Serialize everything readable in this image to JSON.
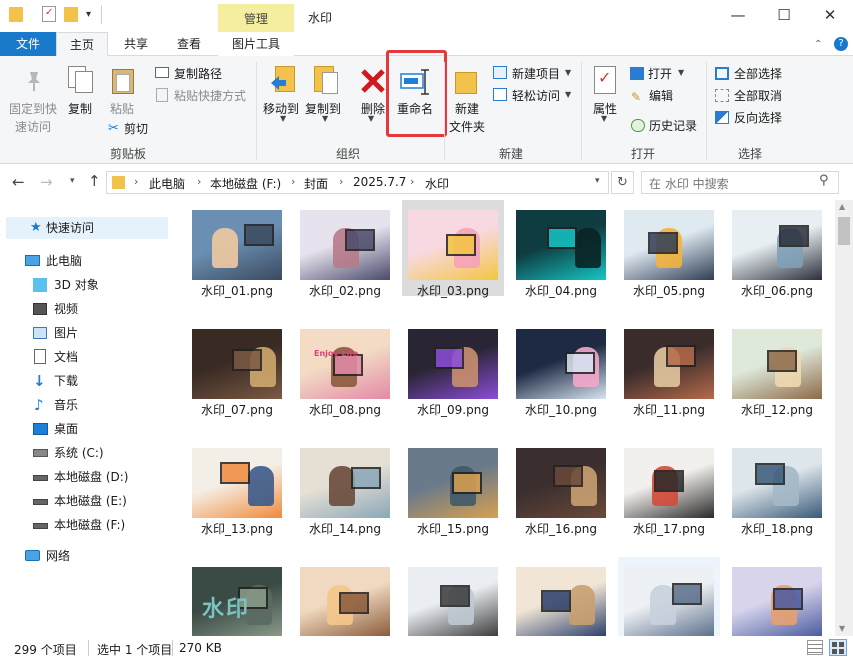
{
  "titlebar": {
    "context_tab": "管理",
    "window_title": "水印",
    "dropdown_glyph": "▾",
    "minimize": "—",
    "maximize": "☐",
    "close": "✕"
  },
  "tabs": {
    "file": "文件",
    "home": "主页",
    "share": "共享",
    "view": "查看",
    "picture_tools": "图片工具"
  },
  "ribbon": {
    "clipboard": {
      "pin_line1": "固定到快",
      "pin_line2": "速访问",
      "copy": "复制",
      "paste": "粘贴",
      "copy_path": "复制路径",
      "paste_shortcut": "粘贴快捷方式",
      "cut": "剪切",
      "group": "剪贴板"
    },
    "organize": {
      "move_to": "移动到",
      "copy_to": "复制到",
      "delete": "删除",
      "rename": "重命名",
      "group": "组织"
    },
    "new": {
      "new_folder_line1": "新建",
      "new_folder_line2": "文件夹",
      "new_item": "新建项目",
      "easy_access": "轻松访问",
      "group": "新建"
    },
    "open": {
      "properties": "属性",
      "open": "打开",
      "edit": "编辑",
      "history": "历史记录",
      "group": "打开"
    },
    "select": {
      "select_all": "全部选择",
      "select_none": "全部取消",
      "invert": "反向选择",
      "group": "选择"
    }
  },
  "address": {
    "crumbs": [
      "此电脑",
      "本地磁盘 (F:)",
      "封面",
      "2025.7.7",
      "水印"
    ],
    "search_placeholder": "在 水印 中搜索"
  },
  "nav": {
    "quick_access": "快速访问",
    "this_pc": "此电脑",
    "objects3d": "3D 对象",
    "videos": "视频",
    "pictures": "图片",
    "documents": "文档",
    "downloads": "下载",
    "music": "音乐",
    "desktop": "桌面",
    "drive_c": "系统 (C:)",
    "drive_d": "本地磁盘 (D:)",
    "drive_e": "本地磁盘 (E:)",
    "drive_f": "本地磁盘 (F:)",
    "network": "网络"
  },
  "files": [
    "水印_01.png",
    "水印_02.png",
    "水印_03.png",
    "水印_04.png",
    "水印_05.png",
    "水印_06.png",
    "水印_07.png",
    "水印_08.png",
    "水印_09.png",
    "水印_10.png",
    "水印_11.png",
    "水印_12.png",
    "水印_13.png",
    "水印_14.png",
    "水印_15.png",
    "水印_16.png",
    "水印_17.png",
    "水印_18.png",
    "",
    "",
    "",
    "",
    "",
    ""
  ],
  "watermark_text": "水印",
  "thumb_text_08": "Enjoy Life",
  "status": {
    "count": "299 个项目",
    "selected": "选中 1 个项目",
    "size": "270 KB"
  },
  "colors": {
    "accent": "#1979ca",
    "context_tab_bg": "#f5eea0",
    "highlight_box": "#e5383b",
    "selected_tile": "#dcdcdc",
    "folder": "#f3c24a"
  }
}
